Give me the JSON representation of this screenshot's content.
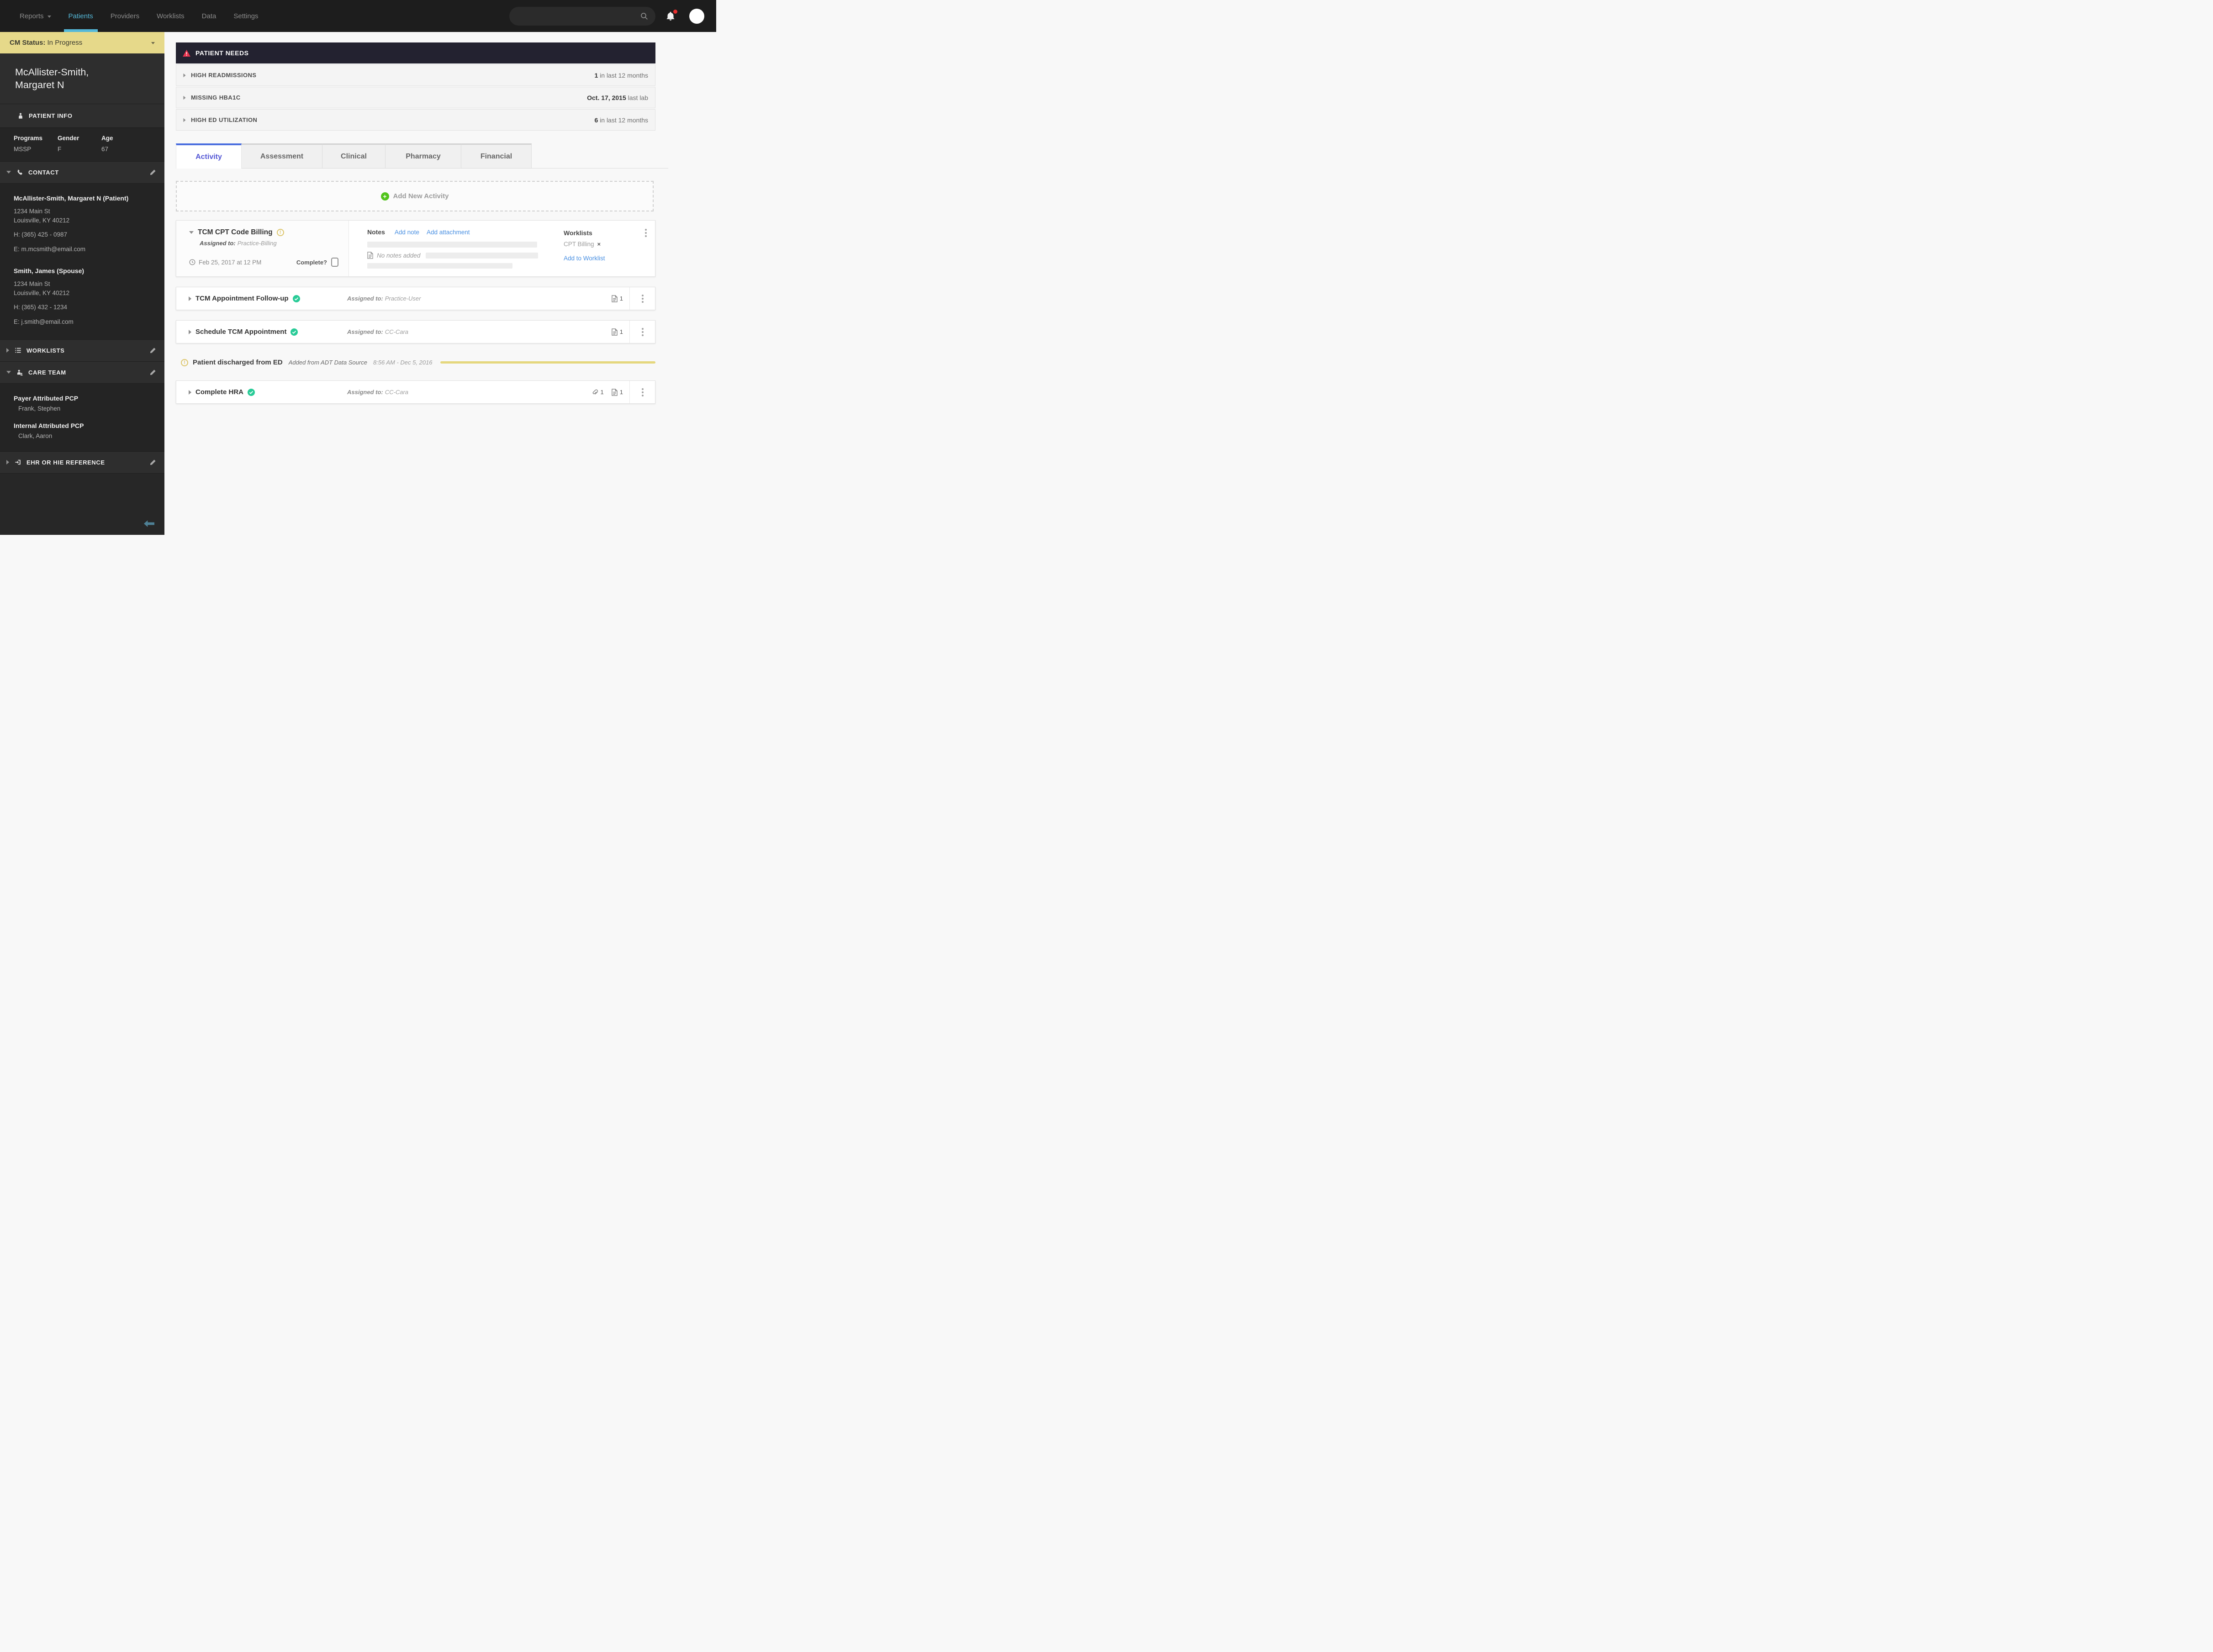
{
  "colors": {
    "nav_active_cyan": "#55b9d9",
    "status_yellow": "#e6d98a",
    "event_yellow": "#e5d77d",
    "alert_red": "#e8344e",
    "tab_active_blue": "#5457d5",
    "link_blue": "#4a90e2",
    "success_green": "#29cb97",
    "add_green": "#52c41d",
    "warning_gold": "#ddc66d"
  },
  "icons": {
    "close": "×",
    "exclaim": "!",
    "plus": "+"
  },
  "nav": {
    "items": [
      {
        "label": "Reports"
      },
      {
        "label": "Patients"
      },
      {
        "label": "Providers"
      },
      {
        "label": "Worklists"
      },
      {
        "label": "Data"
      },
      {
        "label": "Settings"
      }
    ],
    "search_value": ""
  },
  "sidebar": {
    "cm_status": {
      "label": "CM Status:",
      "value": "In Progress"
    },
    "patient_name_line1": "McAllister-Smith,",
    "patient_name_line2": "Margaret N",
    "patient_info": {
      "header": "PATIENT INFO",
      "fields": [
        {
          "label": "Programs",
          "value": "MSSP"
        },
        {
          "label": "Gender",
          "value": "F"
        },
        {
          "label": "Age",
          "value": "67"
        }
      ]
    },
    "contact": {
      "header": "CONTACT",
      "entries": [
        {
          "name": "McAllister-Smith, Margaret N (Patient)",
          "address1": "1234 Main St",
          "address2": "Louisville, KY 40212",
          "phone": "H: (365) 425 - 0987",
          "email": "E: m.mcsmith@email.com"
        },
        {
          "name": "Smith, James (Spouse)",
          "address1": "1234 Main St",
          "address2": "Louisville, KY 40212",
          "phone": "H: (365) 432 - 1234",
          "email": "E: j.smith@email.com"
        }
      ]
    },
    "worklists": {
      "header": "WORKLISTS"
    },
    "care_team": {
      "header": "CARE TEAM",
      "members": [
        {
          "role": "Payer Attributed PCP",
          "name": "Frank, Stephen"
        },
        {
          "role": "Internal Attributed PCP",
          "name": "Clark, Aaron"
        }
      ]
    },
    "ehr": {
      "header": "EHR OR HIE REFERENCE"
    }
  },
  "main": {
    "patient_needs": {
      "title": "PATIENT NEEDS",
      "rows": [
        {
          "label": "HIGH READMISSIONS",
          "value_bold": "1",
          "value_rest": " in last 12 months"
        },
        {
          "label": "MISSING HBA1C",
          "value_bold": "Oct. 17, 2015",
          "value_rest": " last lab"
        },
        {
          "label": "HIGH ED UTILIZATION",
          "value_bold": "6",
          "value_rest": " in last 12 months"
        }
      ]
    },
    "tabs": [
      {
        "label": "Activity"
      },
      {
        "label": "Assessment"
      },
      {
        "label": "Clinical"
      },
      {
        "label": "Pharmacy"
      },
      {
        "label": "Financial"
      }
    ],
    "add_activity_label": "Add New Activity",
    "card": {
      "title": "TCM CPT Code Billing",
      "assigned_label": "Assigned to:",
      "assigned": "Practice-Billing",
      "due": "Feb 25, 2017 at 12 PM",
      "complete_label": "Complete?",
      "notes_label": "Notes",
      "add_note": "Add note",
      "add_attachment": "Add attachment",
      "no_notes": "No notes added",
      "worklists_label": "Worklists",
      "worklist_item": "CPT Billing",
      "add_to_worklist": "Add to Worklist"
    },
    "rows": [
      {
        "title": "TCM Appointment Follow-up",
        "assigned_label": "Assigned to:",
        "assigned": "Practice-User",
        "doc_count": "1"
      },
      {
        "title": "Schedule TCM Appointment",
        "assigned_label": "Assigned to:",
        "assigned": "CC-Cara",
        "doc_count": "1"
      }
    ],
    "event": {
      "title": "Patient discharged from ED",
      "source": "Added from ADT Data Source",
      "time": "8:56 AM - Dec 5, 2016"
    },
    "hra": {
      "title": "Complete HRA",
      "assigned_label": "Assigned to:",
      "assigned": "CC-Cara",
      "attach_count": "1",
      "doc_count": "1"
    }
  }
}
